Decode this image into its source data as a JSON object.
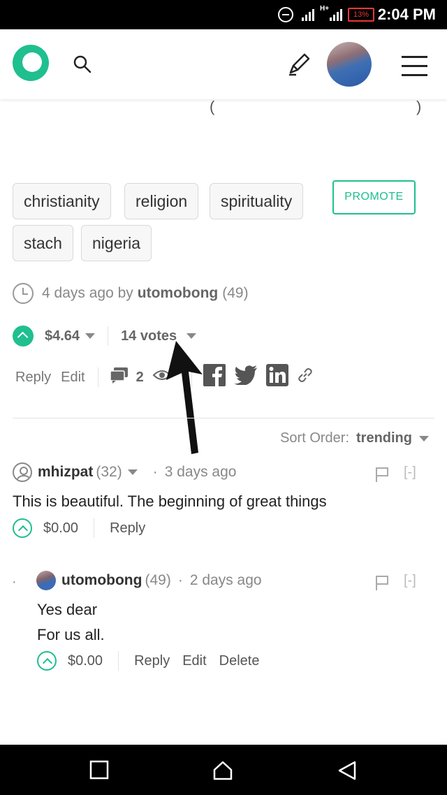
{
  "status_bar": {
    "battery": "13%",
    "time": "2:04 PM",
    "network_label": "H+"
  },
  "header": {
    "icons": [
      "app-logo-icon",
      "search-icon",
      "edit-pen-icon",
      "avatar",
      "menu-icon"
    ]
  },
  "post": {
    "tags": [
      "christianity",
      "religion",
      "spirituality",
      "stach",
      "nigeria"
    ],
    "promote_label": "PROMOTE",
    "meta": {
      "age": "4 days ago by",
      "author": "utomobong",
      "reputation": "(49)"
    },
    "payout": "$4.64",
    "votes": "14 votes",
    "actions": {
      "reply": "Reply",
      "edit": "Edit",
      "comment_count": "2"
    },
    "share_icons": [
      "facebook-icon",
      "twitter-icon",
      "linkedin-icon",
      "link-icon"
    ]
  },
  "comments_section": {
    "sort_label": "Sort Order:",
    "sort_value": "trending"
  },
  "comments": [
    {
      "author": "mhizpat",
      "reputation": "(32)",
      "time": "3 days ago",
      "collapse": "[-]",
      "body": [
        "This is beautiful. The beginning of great things"
      ],
      "payout": "$0.00",
      "actions": [
        "Reply"
      ]
    },
    {
      "author": "utomobong",
      "reputation": "(49)",
      "time": "2 days ago",
      "collapse": "[-]",
      "body": [
        "Yes dear",
        "For us all."
      ],
      "payout": "$0.00",
      "actions": [
        "Reply",
        "Edit",
        "Delete"
      ]
    }
  ],
  "colors": {
    "accent": "#1fbf8f",
    "battery_warning": "#e53935"
  }
}
